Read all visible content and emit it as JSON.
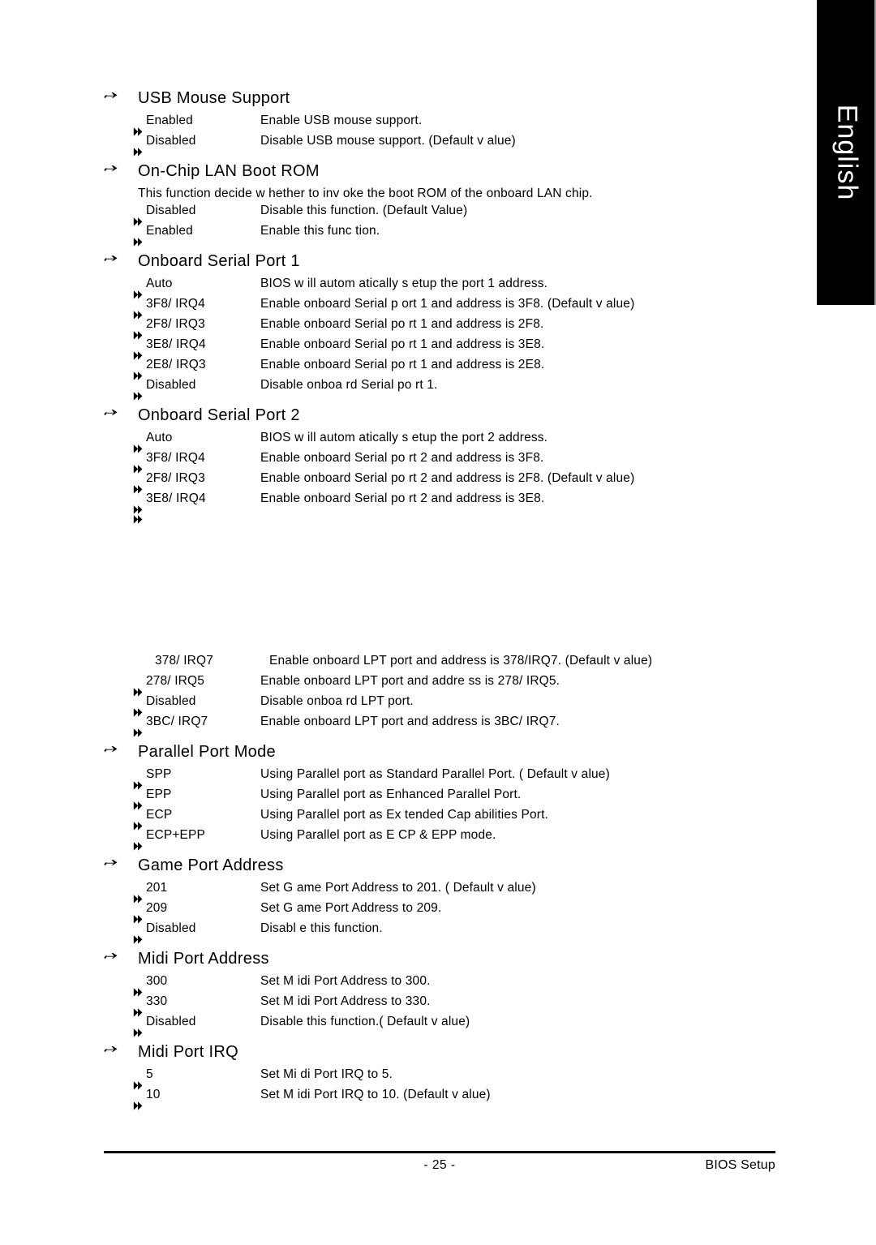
{
  "language_tab": {
    "label": "English"
  },
  "footer": {
    "page_number": "- 25 -",
    "right_label": "BIOS Setup"
  },
  "icons": {
    "section_bullet": "pointing-hand-icon",
    "option_bullet": "double-triangle-icon"
  },
  "sections": [
    {
      "title": "USB Mouse Support",
      "description": "",
      "options": [
        {
          "name": "Enabled",
          "desc": "Enable USB mouse support."
        },
        {
          "name": "Disabled",
          "desc": "Disable USB mouse support. (Default v alue)"
        }
      ]
    },
    {
      "title": "On-Chip  LAN Boot ROM",
      "description": "This  function decide w hether to inv oke the  boot ROM  of the onboard LAN  chip.",
      "options": [
        {
          "name": "Disabled",
          "desc": "Disable this function. (Default Value)"
        },
        {
          "name": "Enabled",
          "desc": "Enable this func tion."
        }
      ]
    },
    {
      "title": "Onboard Serial Port 1",
      "description": "",
      "options": [
        {
          "name": "Auto",
          "desc": "BIOS w ill autom atically  s etup the  port 1 address."
        },
        {
          "name": "3F8/ IRQ4",
          "desc": "Enable onboard  Serial p ort 1 and  address  is 3F8. (Default v alue)"
        },
        {
          "name": "2F8/ IRQ3",
          "desc": "Enable onboard  Serial po rt 1 and  address is  2F8."
        },
        {
          "name": "3E8/ IRQ4",
          "desc": "Enable onboard  Serial po rt 1 and  address  is 3E8."
        },
        {
          "name": "2E8/ IRQ3",
          "desc": "Enable onboard  Serial po rt 1 and  address  is 2E8."
        },
        {
          "name": "Disabled",
          "desc": "Disable onboa rd Serial po rt 1."
        }
      ]
    },
    {
      "title": "Onboard Serial Port 2",
      "description": "",
      "options": [
        {
          "name": "Auto",
          "desc": "BIOS w ill autom atically  s etup the  port 2 address."
        },
        {
          "name": "3F8/ IRQ4",
          "desc": "Enable onboard  Serial po rt 2 and  address  is 3F8."
        },
        {
          "name": "2F8/ IRQ3",
          "desc": "Enable onboard  Serial po rt 2 and  address  is 2F8. (Default v alue)"
        },
        {
          "name": "3E8/ IRQ4",
          "desc": "Enable onboard  Serial po rt 2 and  address  is 3E8."
        },
        {
          "name": "",
          "desc": ""
        }
      ]
    },
    {
      "title": "",
      "description": "",
      "gap_before": true,
      "options": [
        {
          "name": "378/ IRQ7",
          "desc": "Enable onboard LPT port and address is 378/IRQ7. (Default v alue)",
          "no_bullet": true
        },
        {
          "name": "278/ IRQ5",
          "desc": "Enable onboard  LPT port and  addre ss is 278/ IRQ5."
        },
        {
          "name": "Disabled",
          "desc": "Disable onboa rd LPT port."
        },
        {
          "name": "3BC/ IRQ7",
          "desc": "Enable onboard  LPT port and  address is 3BC/ IRQ7."
        }
      ]
    },
    {
      "title": "Parallel Port Mode",
      "description": "",
      "options": [
        {
          "name": "SPP",
          "desc": "Using  Parallel port as  Standard Parallel Port. ( Default v alue)"
        },
        {
          "name": "EPP",
          "desc": "Using  Parallel port as  Enhanced Parallel Port."
        },
        {
          "name": "ECP",
          "desc": "Using  Parallel port as Ex tended Cap abilities  Port."
        },
        {
          "name": "ECP+EPP",
          "desc": "Using  Parallel port as  E CP & EPP  mode."
        }
      ]
    },
    {
      "title": "Game Port Address",
      "description": "",
      "options": [
        {
          "name": "201",
          "desc": "Set G ame Port Address to 201. ( Default v alue)"
        },
        {
          "name": "209",
          "desc": "Set G ame Port Address to  209."
        },
        {
          "name": "Disabled",
          "desc": "Disabl e this function."
        }
      ]
    },
    {
      "title": "Midi  Port Address",
      "description": "",
      "options": [
        {
          "name": "300",
          "desc": "Set M idi Port Address to  300."
        },
        {
          "name": "330",
          "desc": "Set M idi Port Address to  330."
        },
        {
          "name": "Disabled",
          "desc": "Disable this function.( Default v alue)"
        }
      ]
    },
    {
      "title": "Midi  Port IRQ",
      "description": "",
      "options": [
        {
          "name": "5",
          "desc": "Set Mi di Port IRQ  to 5."
        },
        {
          "name": "10",
          "desc": "Set M idi Port IRQ to 10.  (Default v alue)"
        }
      ]
    }
  ]
}
